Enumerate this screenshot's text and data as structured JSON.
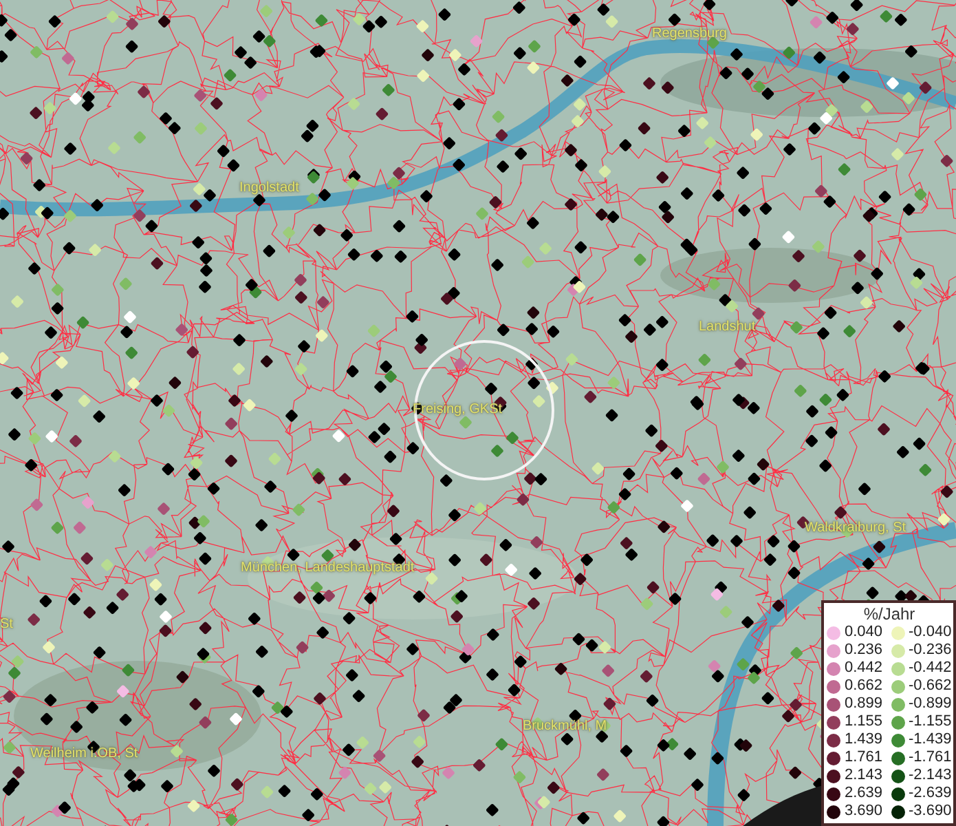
{
  "map": {
    "places": [
      {
        "name": "Regensburg"
      },
      {
        "name": "Ingolstadt"
      },
      {
        "name": "Landshut"
      },
      {
        "name": "Freising, GKSt"
      },
      {
        "name": "München, Landeshauptstadt"
      },
      {
        "name": "Waldkraiburg, St"
      },
      {
        "name": "St"
      },
      {
        "name": "Weilheim i.OB, St"
      },
      {
        "name": "Bruckmühl, M"
      }
    ]
  },
  "legend": {
    "title": "%/Jahr",
    "rows": [
      {
        "positive": {
          "label": "0.040",
          "color": "#f4bce4"
        },
        "negative": {
          "label": "-0.040",
          "color": "#eef4b8"
        }
      },
      {
        "positive": {
          "label": "0.236",
          "color": "#e6a2cc"
        },
        "negative": {
          "label": "-0.236",
          "color": "#d6eaa8"
        }
      },
      {
        "positive": {
          "label": "0.442",
          "color": "#d484b0"
        },
        "negative": {
          "label": "-0.442",
          "color": "#b8dc92"
        }
      },
      {
        "positive": {
          "label": "0.662",
          "color": "#c06a92"
        },
        "negative": {
          "label": "-0.662",
          "color": "#9ccc7a"
        }
      },
      {
        "positive": {
          "label": "0.899",
          "color": "#a85276"
        },
        "negative": {
          "label": "-0.899",
          "color": "#80bc64"
        }
      },
      {
        "positive": {
          "label": "1.155",
          "color": "#923e5c"
        },
        "negative": {
          "label": "-1.155",
          "color": "#5ea44a"
        }
      },
      {
        "positive": {
          "label": "1.439",
          "color": "#7c2c46"
        },
        "negative": {
          "label": "-1.439",
          "color": "#3e8a36"
        }
      },
      {
        "positive": {
          "label": "1.761",
          "color": "#641c32"
        },
        "negative": {
          "label": "-1.761",
          "color": "#266e24"
        }
      },
      {
        "positive": {
          "label": "2.143",
          "color": "#4c1020"
        },
        "negative": {
          "label": "-2.143",
          "color": "#145216"
        }
      },
      {
        "positive": {
          "label": "2.639",
          "color": "#380814"
        },
        "negative": {
          "label": "-2.639",
          "color": "#0a3a0c"
        }
      },
      {
        "positive": {
          "label": "3.690",
          "color": "#22040a"
        },
        "negative": {
          "label": "-3.690",
          "color": "#042206"
        }
      }
    ]
  }
}
